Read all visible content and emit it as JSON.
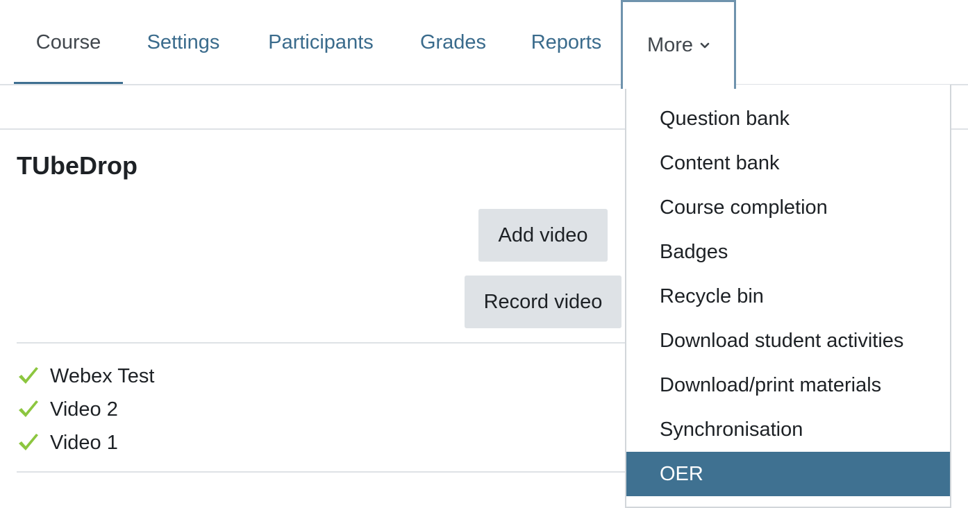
{
  "tabs": [
    {
      "label": "Course",
      "active": true
    },
    {
      "label": "Settings",
      "active": false
    },
    {
      "label": "Participants",
      "active": false
    },
    {
      "label": "Grades",
      "active": false
    },
    {
      "label": "Reports",
      "active": false
    }
  ],
  "more_tab": {
    "label": "More",
    "icon": "chevron-down-icon",
    "expanded": true
  },
  "block": {
    "title": "TUbeDrop",
    "add_video_label": "Add video",
    "record_video_label": "Record video",
    "videos": [
      {
        "title": "Webex Test",
        "status_icon": "checkmark-icon"
      },
      {
        "title": "Video 2",
        "status_icon": "checkmark-icon"
      },
      {
        "title": "Video 1",
        "status_icon": "checkmark-icon"
      }
    ]
  },
  "more_menu": {
    "items": [
      {
        "label": "Question bank"
      },
      {
        "label": "Content bank"
      },
      {
        "label": "Course completion"
      },
      {
        "label": "Badges"
      },
      {
        "label": "Recycle bin"
      },
      {
        "label": "Download student activities"
      },
      {
        "label": "Download/print materials"
      },
      {
        "label": "Synchronisation"
      },
      {
        "label": "OER",
        "selected": true
      }
    ]
  },
  "colors": {
    "link": "#3a6b8c",
    "active_underline": "#3f6f91",
    "selected_bg": "#3f7191",
    "button_bg": "#dee2e6",
    "check_green": "#8cc63f"
  }
}
